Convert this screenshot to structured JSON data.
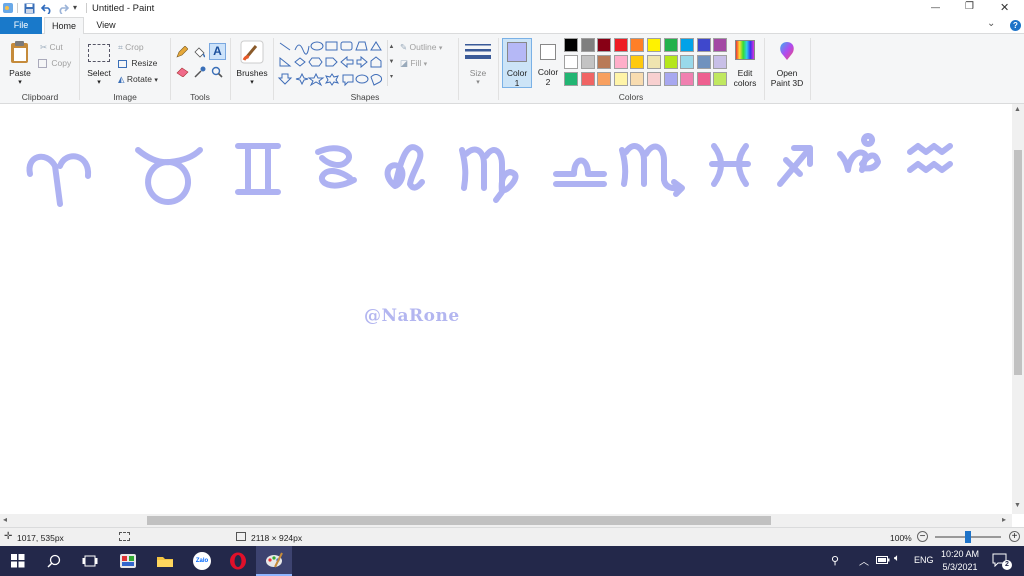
{
  "titlebar": {
    "title": "Untitled - Paint",
    "minimize_glyph": "—",
    "restore_glyph": "❐",
    "close_glyph": "✕",
    "qat_dropdown_glyph": "▾"
  },
  "ribbon_tabs": {
    "file": "File",
    "home": "Home",
    "view": "View",
    "collapse_glyph": "⌄",
    "help_glyph": "?"
  },
  "clipboard": {
    "group_label": "Clipboard",
    "paste": "Paste",
    "cut": "Cut",
    "copy": "Copy"
  },
  "image": {
    "group_label": "Image",
    "select": "Select",
    "crop": "Crop",
    "resize": "Resize",
    "rotate": "Rotate"
  },
  "tools": {
    "group_label": "Tools",
    "text_glyph": "A"
  },
  "brushes": {
    "label": "Brushes"
  },
  "shapes": {
    "group_label": "Shapes",
    "outline": "Outline",
    "fill": "Fill"
  },
  "size": {
    "label": "Size"
  },
  "colors": {
    "group_label": "Colors",
    "color1_label": "Color",
    "color1_num": "1",
    "color2_label": "Color",
    "color2_num": "2",
    "color1_value": "#b5b8f6",
    "color2_value": "#ffffff",
    "edit_colors_line1": "Edit",
    "edit_colors_line2": "colors",
    "palette_row1": [
      "#000000",
      "#7f7f7f",
      "#880015",
      "#ed1c24",
      "#ff7f27",
      "#fff200",
      "#22b14c",
      "#00a2e8",
      "#3f48cc",
      "#a349a4"
    ],
    "palette_row2": [
      "#ffffff",
      "#c3c3c3",
      "#b97a57",
      "#ffaec9",
      "#ffc90e",
      "#efe4b0",
      "#b5e61d",
      "#99d9ea",
      "#7092be",
      "#c8bfe7"
    ],
    "palette_row3": [
      "#22b573",
      "#f06464",
      "#f8a060",
      "#fff4a8",
      "#f8dcb0",
      "#f8d0d0",
      "#a8a8f0",
      "#f080b0",
      "#ee6090",
      "#c0e860"
    ]
  },
  "paint3d": {
    "line1": "Open",
    "line2": "Paint 3D"
  },
  "canvas": {
    "zodiac_symbols": [
      "♈",
      "♉",
      "♊",
      "♋",
      "♌",
      "♍",
      "♎",
      "♏",
      "♓",
      "♐",
      "♑",
      "♒"
    ],
    "watermark": "@NaRone",
    "stroke_color": "#aeb2f2"
  },
  "statusbar": {
    "cursor_pos": "1017, 535px",
    "canvas_size": "2118 × 924px",
    "zoom": "100%",
    "zoom_fraction": 0.5
  },
  "taskbar": {
    "language": "ENG",
    "time": "10:20 AM",
    "date": "5/3/2021",
    "notifications": "2",
    "zalo_label": "Zalo"
  }
}
